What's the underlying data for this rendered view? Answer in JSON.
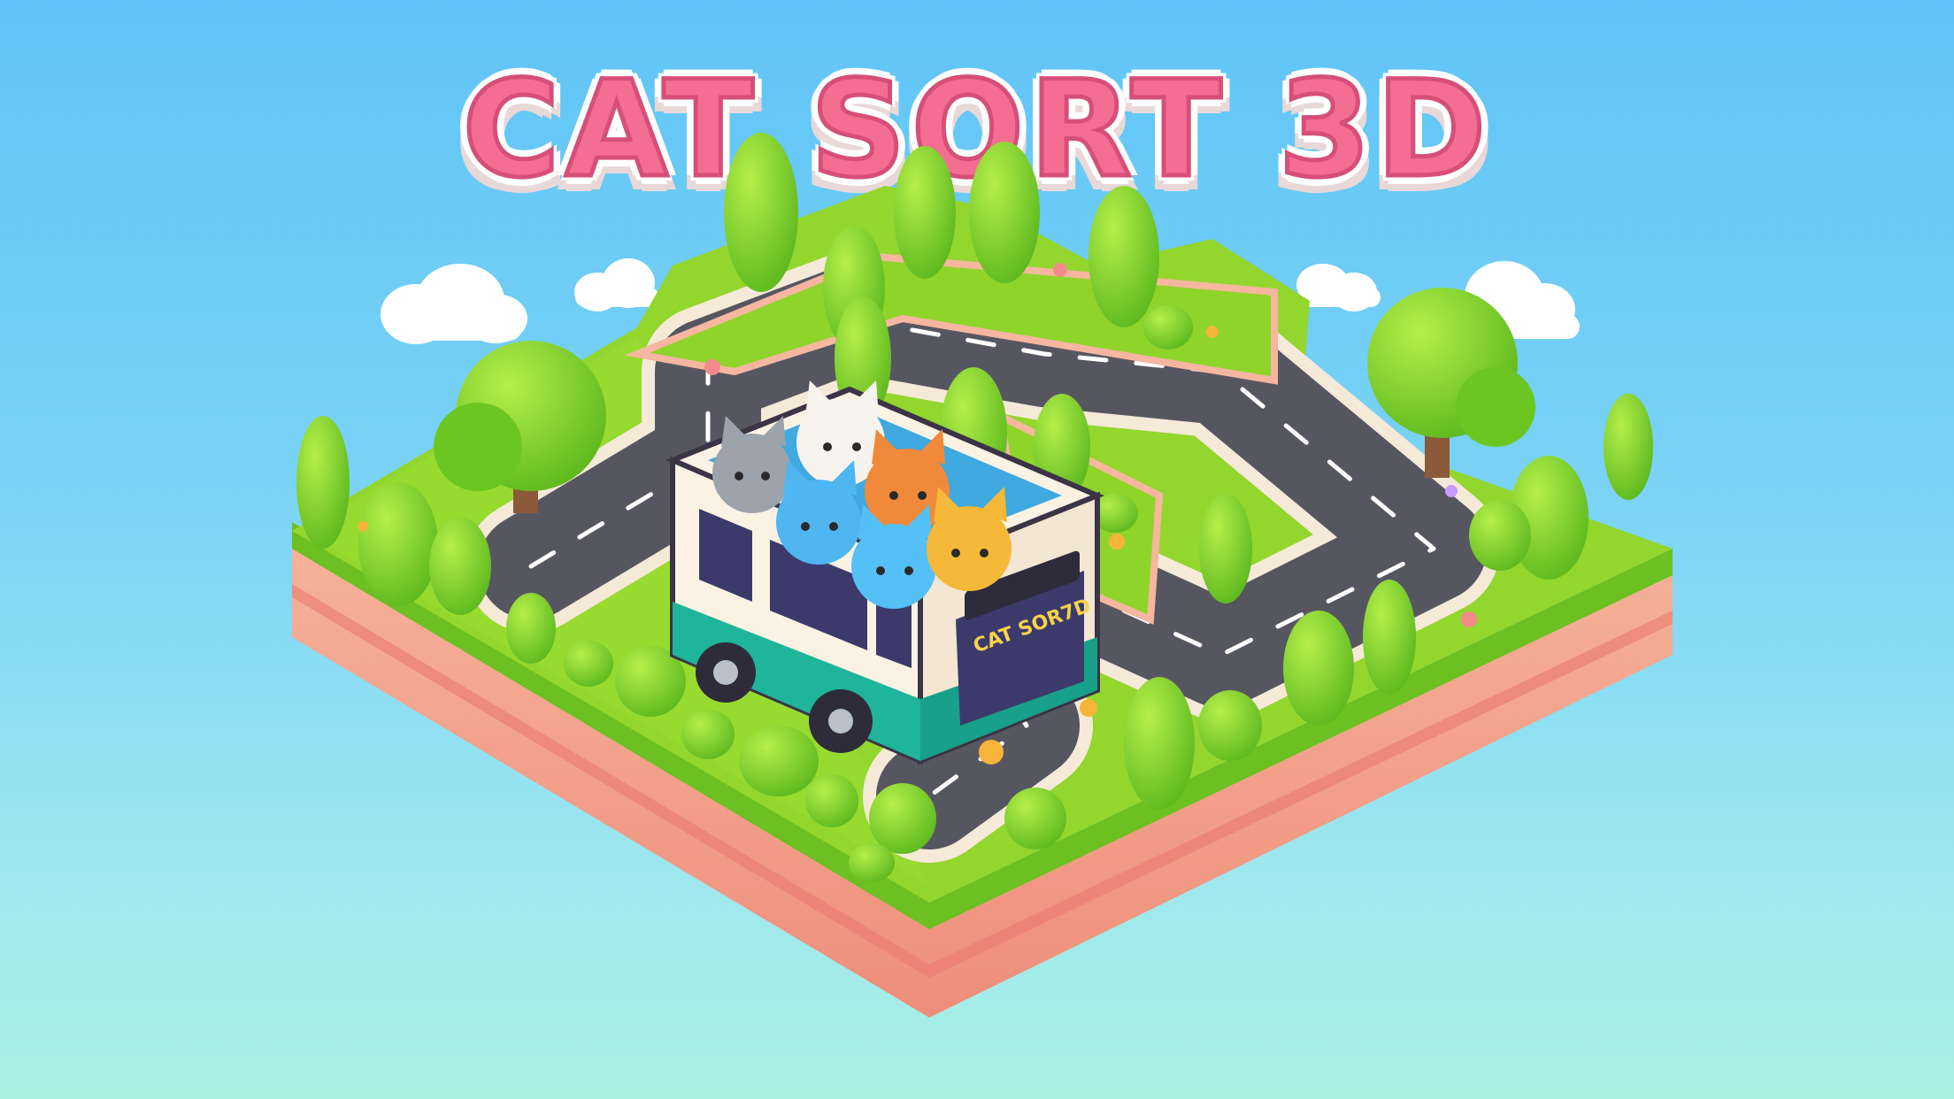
{
  "game": {
    "title": "CAT SORT 3D",
    "bus_sign": "CAT SOR7D"
  },
  "colors": {
    "title_fill": "#f46d92",
    "grass": "#8fd42b",
    "road": "#555560",
    "soil": "#f3a48c",
    "bus_body": "#fbf2e4",
    "bus_stripe": "#1fb59a"
  },
  "icons": {
    "clouds": "cloud-icon",
    "trees": "tree-icon",
    "cats": "cat-icon"
  }
}
